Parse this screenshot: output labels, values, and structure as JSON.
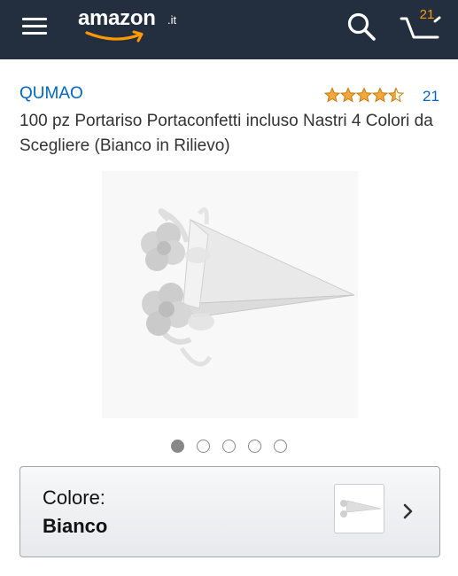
{
  "header": {
    "logo_text": "amazon",
    "logo_tld": ".it",
    "cart_count": "21",
    "background_color": "#232f3e",
    "accent_color": "#ff9900"
  },
  "product": {
    "brand": "QUMAO",
    "rating_stars": 4.5,
    "review_count": "21",
    "title": "100 pz Portariso Portaconfetti incluso Nastri 4 Colori da Scegliere (Bianco in Rilievo)",
    "link_color": "#0066c0",
    "star_color": "#e47911"
  },
  "gallery": {
    "image_count": 5,
    "active_index": 0
  },
  "variant": {
    "label": "Colore:",
    "value": "Bianco"
  },
  "icons": {
    "menu": "hamburger-menu-icon",
    "search": "search-icon",
    "cart": "cart-icon",
    "chevron": "chevron-right-icon"
  }
}
